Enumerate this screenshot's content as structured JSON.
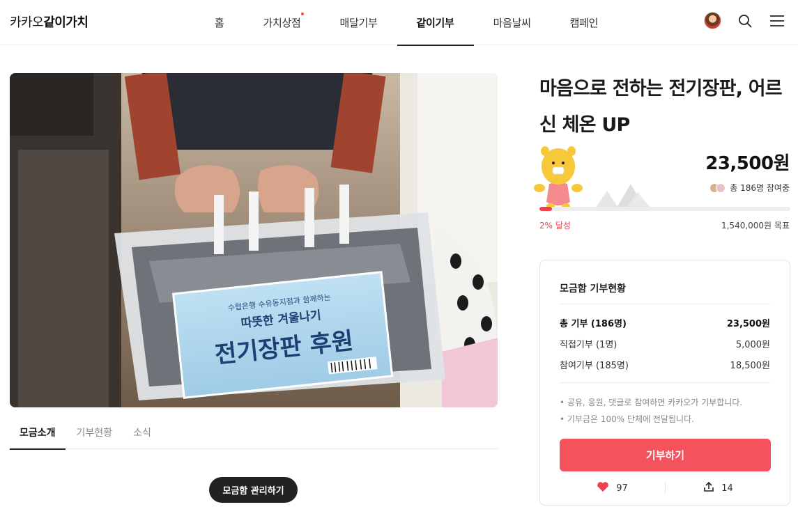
{
  "header": {
    "logo_prefix": "카카오",
    "logo_main": "같이가치",
    "nav": [
      {
        "label": "홈"
      },
      {
        "label": "가치상점"
      },
      {
        "label": "매달기부"
      },
      {
        "label": "같이기부"
      },
      {
        "label": "마음날씨"
      },
      {
        "label": "캠페인"
      }
    ],
    "active_nav": "같이기부"
  },
  "tabs": [
    {
      "label": "모금소개"
    },
    {
      "label": "기부현황"
    },
    {
      "label": "소식"
    }
  ],
  "manage_button": "모금함 관리하기",
  "campaign": {
    "title": "마음으로 전하는 전기장판, 어르신 체온 UP",
    "amount": "23,500원",
    "participants": "총 186명 참여중",
    "progress_percent": 2,
    "achieved": "2% 달성",
    "goal": "1,540,000원 목표"
  },
  "status_card": {
    "title": "모금함 기부현황",
    "rows": [
      {
        "label": "총 기부 (186명)",
        "value": "23,500원"
      },
      {
        "label": "직접기부 (1명)",
        "value": "5,000원"
      },
      {
        "label": "참여기부 (185명)",
        "value": "18,500원"
      }
    ],
    "notes": [
      "• 공유, 응원, 댓글로 참여하면 카카오가 기부합니다.",
      "• 기부금은 100% 단체에 전달됩니다."
    ],
    "donate_label": "기부하기",
    "likes": "97",
    "shares": "14"
  },
  "hero_image": {
    "banner_top": "수협은행 수유동지점과 함께하는",
    "banner_mid": "따뜻한 겨울나기",
    "banner_main": "전기장판 후원"
  },
  "colors": {
    "accent": "#f4535e",
    "progress": "#f0404e"
  }
}
